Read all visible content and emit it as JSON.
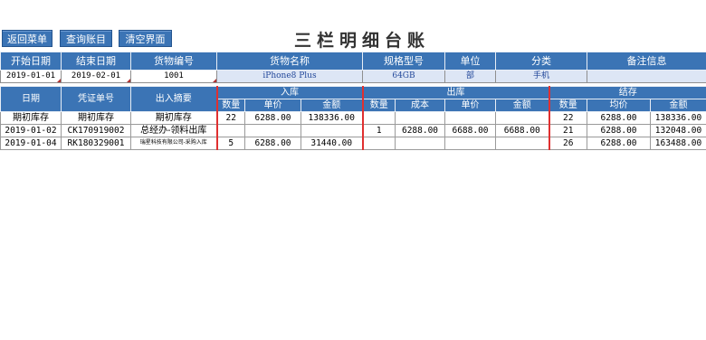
{
  "toolbar": {
    "back": "返回菜单",
    "query": "查询账目",
    "clear": "清空界面"
  },
  "title": "三栏明细台账",
  "filter_header": {
    "start_date": "开始日期",
    "end_date": "结束日期",
    "item_code": "货物编号",
    "item_name": "货物名称",
    "spec": "规格型号",
    "unit": "单位",
    "category": "分类",
    "remark": "备注信息"
  },
  "filter_values": {
    "start_date": "2019-01-01",
    "end_date": "2019-02-01",
    "item_code": "1001",
    "item_name": "iPhone8 Plus",
    "spec": "64GB",
    "unit": "部",
    "category": "手机",
    "remark": ""
  },
  "ledger_header": {
    "date": "日期",
    "voucher": "凭证单号",
    "summary": "出入摘要",
    "in_group": "入库",
    "out_group": "出库",
    "bal_group": "结存",
    "in_qty": "数量",
    "in_price": "单价",
    "in_amount": "金额",
    "out_qty": "数量",
    "out_cost": "成本",
    "out_price": "单价",
    "out_amount": "金额",
    "bal_qty": "数量",
    "bal_avg": "均价",
    "bal_amount": "金额"
  },
  "rows": [
    {
      "date": "期初库存",
      "voucher": "期初库存",
      "summary": "期初库存",
      "in_qty": "22",
      "in_price": "6288.00",
      "in_amount": "138336.00",
      "out_qty": "",
      "out_cost": "",
      "out_price": "",
      "out_amount": "",
      "bal_qty": "22",
      "bal_avg": "6288.00",
      "bal_amount": "138336.00"
    },
    {
      "date": "2019-01-02",
      "voucher": "CK170919002",
      "summary": "总经办-领料出库",
      "in_qty": "",
      "in_price": "",
      "in_amount": "",
      "out_qty": "1",
      "out_cost": "6288.00",
      "out_price": "6688.00",
      "out_amount": "6688.00",
      "bal_qty": "21",
      "bal_avg": "6288.00",
      "bal_amount": "132048.00"
    },
    {
      "date": "2019-01-04",
      "voucher": "RK180329001",
      "summary": "瑞星科技有限公司-采购入库",
      "in_qty": "5",
      "in_price": "6288.00",
      "in_amount": "31440.00",
      "out_qty": "",
      "out_cost": "",
      "out_price": "",
      "out_amount": "",
      "bal_qty": "26",
      "bal_avg": "6288.00",
      "bal_amount": "163488.00"
    }
  ],
  "colors": {
    "header_blue": "#3b74b5",
    "light_blue": "#dde6f5",
    "divider_red": "#e03030"
  }
}
